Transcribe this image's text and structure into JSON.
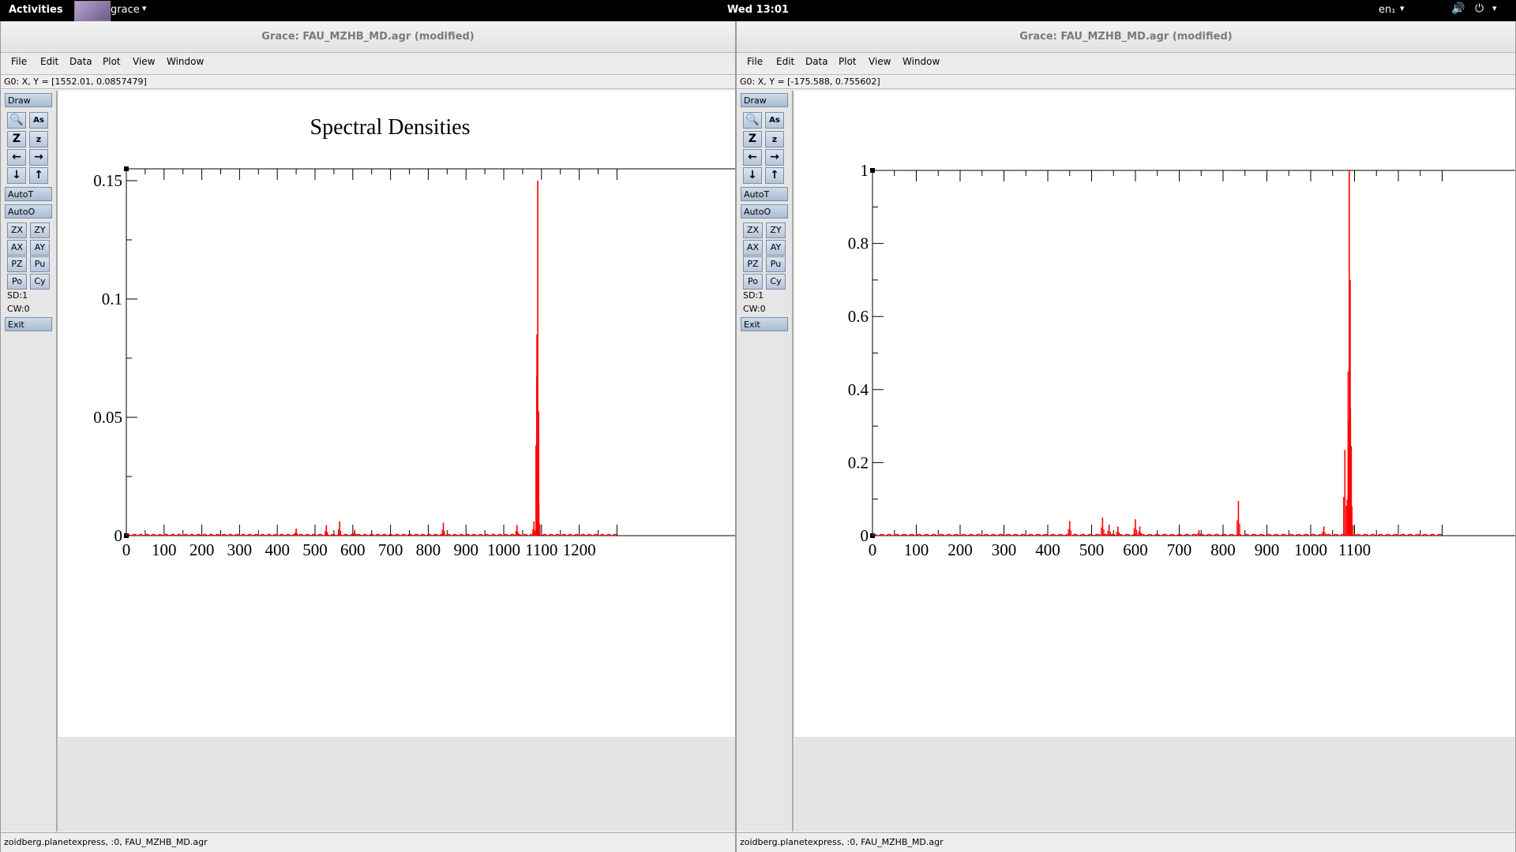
{
  "topbar": {
    "activities": "Activities",
    "app_name": "grace",
    "clock": "Wed 13:01",
    "lang": "en₁"
  },
  "windows": [
    {
      "title": "Grace: FAU_MZHB_MD.agr (modified)",
      "menu": [
        "File",
        "Edit",
        "Data",
        "Plot",
        "View",
        "Window"
      ],
      "coords": "G0: X, Y = [1552.01, 0.0857479]",
      "tools": {
        "draw": "Draw",
        "autot": "AutoT",
        "autoo": "AutoO",
        "zx": "ZX",
        "zy": "ZY",
        "ax": "AX",
        "ay": "AY",
        "pz": "PZ",
        "pu": "Pu",
        "po": "Po",
        "cy": "Cy",
        "sd": "SD:1",
        "cw": "CW:0",
        "exit": "Exit"
      },
      "status": "zoidberg.planetexpress, :0, FAU_MZHB_MD.agr"
    },
    {
      "title": "Grace: FAU_MZHB_MD.agr (modified)",
      "menu": [
        "File",
        "Edit",
        "Data",
        "Plot",
        "View",
        "Window"
      ],
      "coords": "G0: X, Y = [-175.588, 0.755602]",
      "tools": {
        "draw": "Draw",
        "autot": "AutoT",
        "autoo": "AutoO",
        "zx": "ZX",
        "zy": "ZY",
        "ax": "AX",
        "ay": "AY",
        "pz": "PZ",
        "pu": "Pu",
        "po": "Po",
        "cy": "Cy",
        "sd": "SD:1",
        "cw": "CW:0",
        "exit": "Exit"
      },
      "status": "zoidberg.planetexpress, :0, FAU_MZHB_MD.agr"
    }
  ],
  "chart_data": [
    {
      "type": "line",
      "title": "Spectral Densities",
      "xlim": [
        0,
        1260
      ],
      "ylim": [
        0,
        0.155
      ],
      "xticks": [
        "0",
        "100",
        "200",
        "300",
        "400",
        "500",
        "600",
        "700",
        "800",
        "900",
        "1000",
        "1100",
        "1200"
      ],
      "yticks": [
        "0",
        "0.05",
        "0.1",
        "0.15"
      ],
      "ytick_values": [
        0,
        0.05,
        0.1,
        0.15
      ],
      "color": "#ff0000",
      "peaks": [
        [
          450,
          0.003
        ],
        [
          530,
          0.0045
        ],
        [
          565,
          0.006
        ],
        [
          605,
          0.0025
        ],
        [
          840,
          0.0055
        ],
        [
          1035,
          0.0045
        ],
        [
          1080,
          0.006
        ],
        [
          1088,
          0.085
        ],
        [
          1090,
          0.15
        ],
        [
          1093,
          0.014
        ]
      ]
    },
    {
      "type": "line",
      "title": "",
      "xlim": [
        0,
        1170
      ],
      "ylim": [
        0,
        1
      ],
      "xticks": [
        "0",
        "100",
        "200",
        "300",
        "400",
        "500",
        "600",
        "700",
        "800",
        "900",
        "1000",
        "1100"
      ],
      "yticks": [
        "0",
        "0.2",
        "0.4",
        "0.6",
        "0.8",
        "1"
      ],
      "ytick_values": [
        0,
        0.2,
        0.4,
        0.6,
        0.8,
        1
      ],
      "color": "#ff0000",
      "peaks": [
        [
          450,
          0.04
        ],
        [
          525,
          0.05
        ],
        [
          540,
          0.03
        ],
        [
          560,
          0.025
        ],
        [
          600,
          0.045
        ],
        [
          610,
          0.025
        ],
        [
          745,
          0.015
        ],
        [
          835,
          0.095
        ],
        [
          1030,
          0.025
        ],
        [
          1078,
          0.235
        ],
        [
          1086,
          0.22
        ],
        [
          1088,
          1.0
        ],
        [
          1090,
          0.7
        ],
        [
          1094,
          0.08
        ]
      ]
    }
  ]
}
